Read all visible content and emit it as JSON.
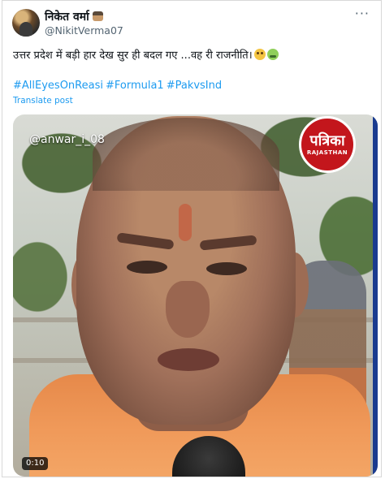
{
  "user": {
    "display_name": "निकेत वर्मा",
    "handle": "@NikitVerma07"
  },
  "tweet": {
    "text": "उत्तर प्रदेश में बड़ी हार देख सुर ही बदल गए ...वह री राजनीति।",
    "hashtags": [
      "#AllEyesOnReasi",
      "#Formula1",
      "#PakvsInd"
    ],
    "translate_label": "Translate post"
  },
  "video": {
    "watermark": "@anwar_i_08",
    "logo_line1": "पत्रिका",
    "logo_line2": "RAJASTHAN",
    "duration": "0:10"
  },
  "icons": {
    "more": "more-icon",
    "emoji_flushed": "flushed-face-icon",
    "emoji_sick": "nauseated-face-icon"
  },
  "colors": {
    "link": "#1d9bf0",
    "secondary_text": "#536471",
    "logo_red": "#c3161c"
  }
}
